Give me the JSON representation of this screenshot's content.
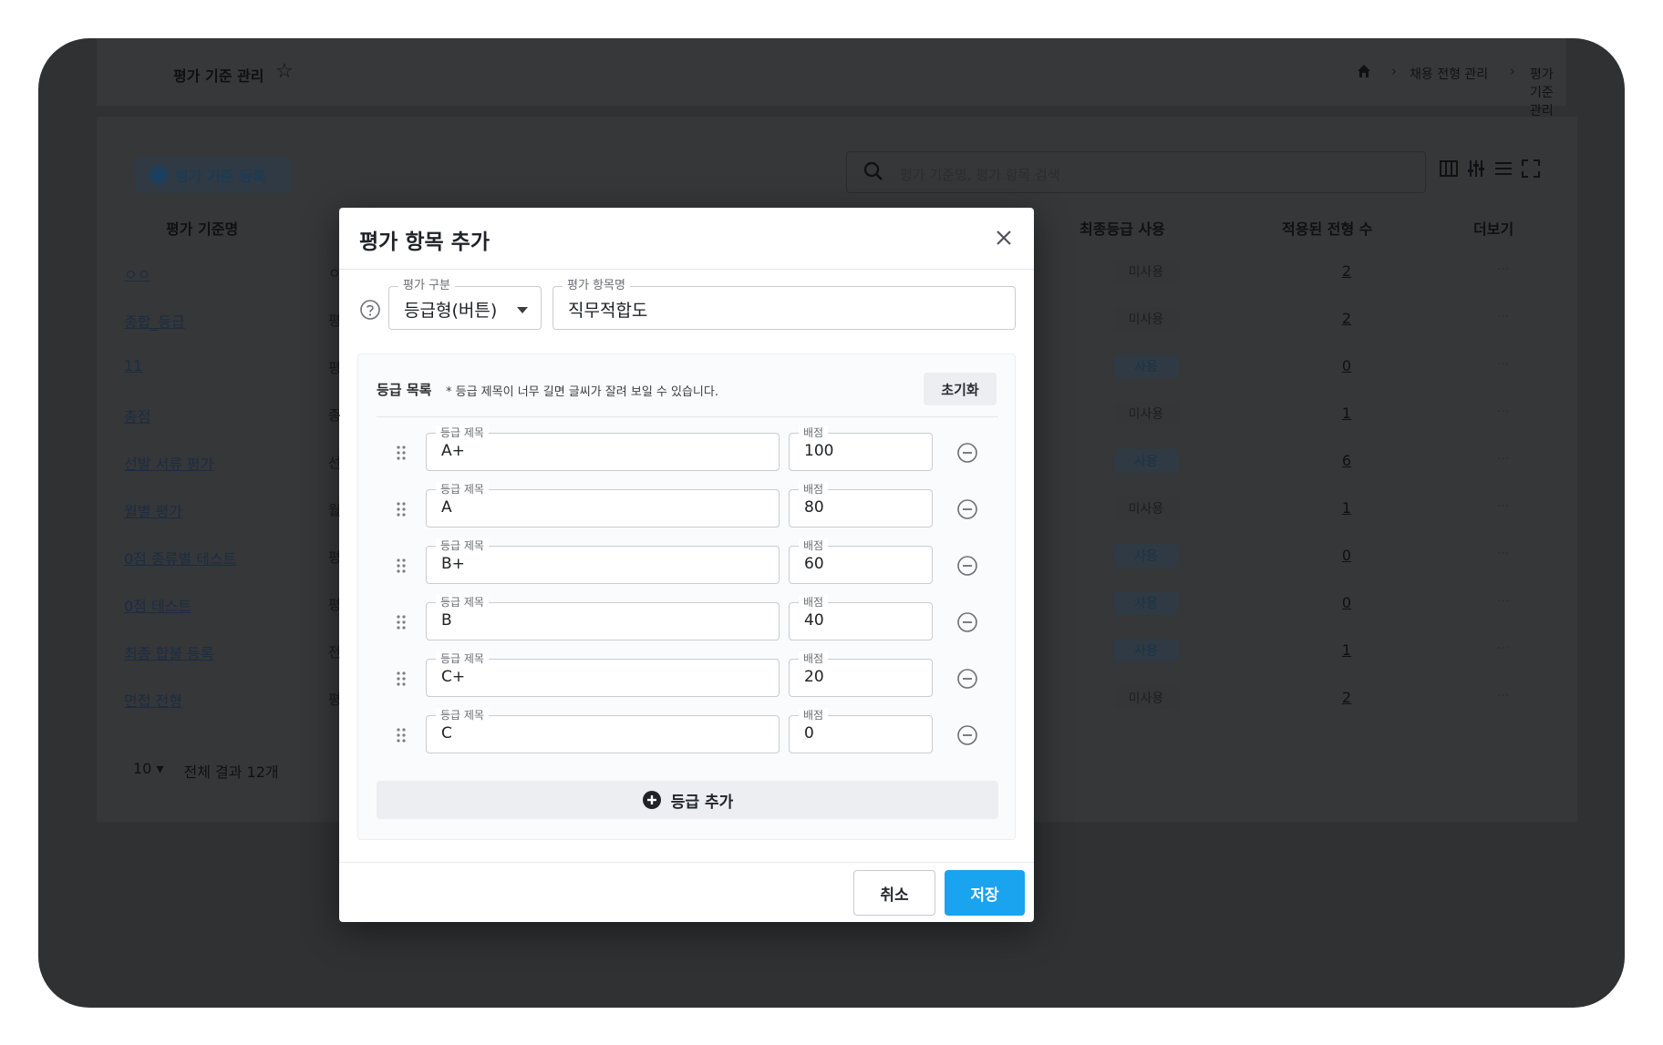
{
  "background": {
    "page_title": "평가 기준 관리",
    "breadcrumb": [
      "채용 전형 관리",
      "평가 기준 관리"
    ],
    "register_button": "평가 기준 등록",
    "search_placeholder": "평가 기준명, 평가 항목 검색",
    "columns": [
      "평가 기준명",
      "최종등급 사용",
      "적용된 전형 수",
      "더보기"
    ],
    "rows": [
      {
        "name": "ㅇㅇ",
        "cut": "ㅇ",
        "use": "미사용",
        "use_flag": false,
        "count": "2"
      },
      {
        "name": "종합_등급",
        "cut": "평",
        "use": "미사용",
        "use_flag": false,
        "count": "2"
      },
      {
        "name": "11",
        "cut": "평",
        "use": "사용",
        "use_flag": true,
        "count": "0"
      },
      {
        "name": "총점",
        "cut": "종",
        "use": "미사용",
        "use_flag": false,
        "count": "1"
      },
      {
        "name": "선발 서류 평가",
        "cut": "선",
        "use": "사용",
        "use_flag": true,
        "count": "6"
      },
      {
        "name": "월별 평가",
        "cut": "월",
        "use": "미사용",
        "use_flag": false,
        "count": "1"
      },
      {
        "name": "0점 종류별 테스트",
        "cut": "평",
        "use": "사용",
        "use_flag": true,
        "count": "0"
      },
      {
        "name": "0점 테스트",
        "cut": "평",
        "use": "사용",
        "use_flag": true,
        "count": "0"
      },
      {
        "name": "최종 합불 등록",
        "cut": "전",
        "use": "사용",
        "use_flag": true,
        "count": "1"
      },
      {
        "name": "면접 전형",
        "cut": "평",
        "use": "미사용",
        "use_flag": false,
        "count": "2"
      }
    ],
    "more_label": "···",
    "page_size": "10",
    "total_label": "전체 결과 12개"
  },
  "modal": {
    "title": "평가 항목 추가",
    "type_label": "평가 구분",
    "type_value": "등급형(버튼)",
    "name_label": "평가 항목명",
    "name_value": "직무적합도",
    "grade_list_title": "등급 목록",
    "grade_list_note": "* 등급 제목이 너무 길면 글씨가 잘려 보일 수 있습니다.",
    "reset_button": "초기화",
    "grade_title_label": "등급 제목",
    "score_label": "배점",
    "grades": [
      {
        "title": "A+",
        "score": "100"
      },
      {
        "title": "A",
        "score": "80"
      },
      {
        "title": "B+",
        "score": "60"
      },
      {
        "title": "B",
        "score": "40"
      },
      {
        "title": "C+",
        "score": "20"
      },
      {
        "title": "C",
        "score": "0"
      }
    ],
    "add_grade_button": "등급 추가",
    "cancel_button": "취소",
    "save_button": "저장"
  },
  "colors": {
    "overlay": "#303133",
    "primary": "#1aa3ef",
    "modal_bg": "#ffffff"
  }
}
